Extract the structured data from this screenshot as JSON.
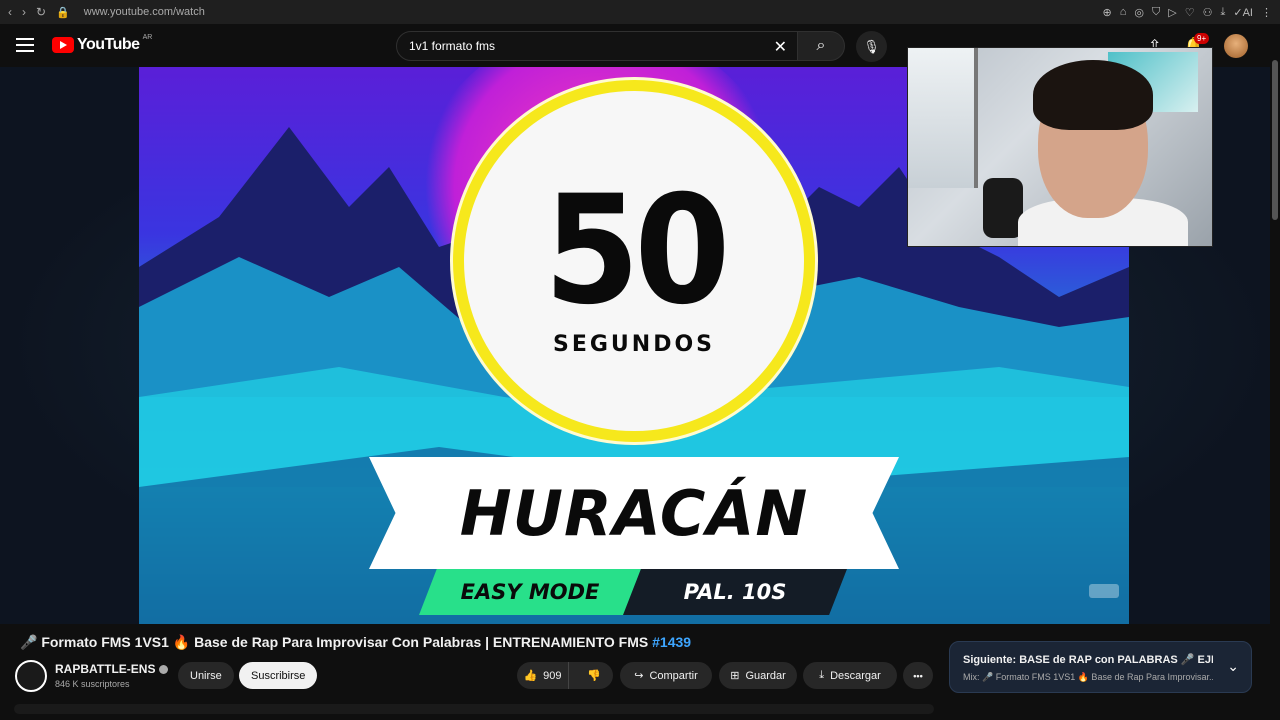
{
  "browser": {
    "url": "www.youtube.com/watch",
    "nav_back": "‹",
    "nav_forward": "›",
    "reload": "↻",
    "extensions": [
      "⊕",
      "⌂",
      "◎",
      "⛉",
      "▷",
      "♡",
      "⚇",
      "⤓",
      "✓AI",
      "⋮"
    ]
  },
  "header": {
    "logo_text": "YouTube",
    "region": "AR",
    "search_value": "1v1 formato fms",
    "clear_glyph": "✕",
    "search_glyph": "⌕",
    "mic_glyph": "🎙",
    "upload_glyph": "⇧",
    "bell_glyph": "🔔",
    "notification_count": "9+"
  },
  "video": {
    "timer_number": "50",
    "timer_unit": "SEGUNDOS",
    "word": "HURACÁN",
    "mode": "EASY MODE",
    "interval": "PAL. 10S"
  },
  "info": {
    "title": "🎤 Formato FMS 1VS1 🔥 Base de Rap Para Improvisar Con Palabras | ENTRENAMIENTO FMS",
    "title_tag": "#1439",
    "channel_name": "RAPBATTLE-ENS",
    "subscribers": "846 K suscriptores",
    "join_label": "Unirse",
    "subscribe_label": "Suscribirse",
    "like_count": "909",
    "like_glyph": "👍",
    "dislike_glyph": "👎",
    "share_glyph": "↪",
    "save_glyph": "⊞",
    "download_glyph": "⤓",
    "share_label": "Compartir",
    "save_label": "Guardar",
    "download_label": "Descargar",
    "more_glyph": "•••"
  },
  "next": {
    "title": "Siguiente: BASE de RAP con PALABRAS 🎤 EJERCI...",
    "subtitle": "Mix: 🎤 Formato FMS 1VS1 🔥 Base de Rap Para Improvisar...",
    "chevron": "⌄"
  }
}
